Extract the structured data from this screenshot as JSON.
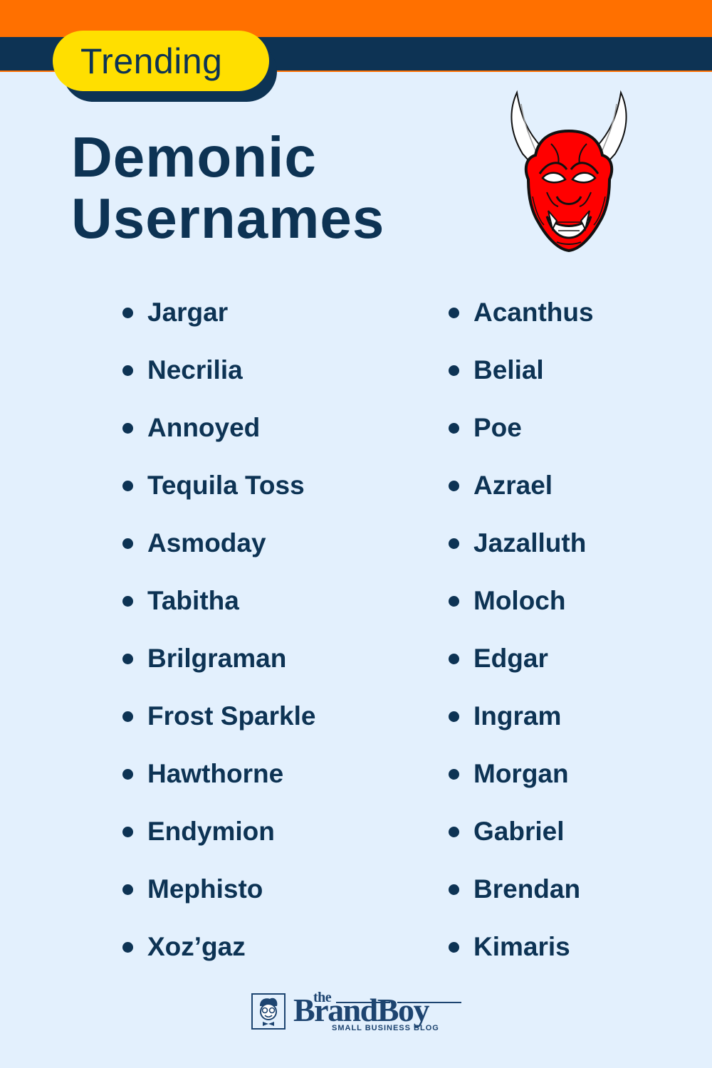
{
  "badge": {
    "label": "Trending"
  },
  "title": {
    "line1": "Demonic",
    "line2": "Usernames"
  },
  "illustration": {
    "icon": "oni-demon-mask-icon"
  },
  "lists": {
    "left": [
      "Jargar",
      "Necrilia",
      "Annoyed",
      "Tequila Toss",
      "Asmoday",
      "Tabitha",
      "Brilgraman",
      "Frost Sparkle",
      "Hawthorne",
      "Endymion",
      "Mephisto",
      "Xoz’gaz"
    ],
    "right": [
      "Acanthus",
      "Belial",
      "Poe",
      "Azrael",
      "Jazalluth",
      "Moloch",
      "Edgar",
      "Ingram",
      "Morgan",
      "Gabriel",
      "Brendan",
      "Kimaris"
    ]
  },
  "footer": {
    "logo_the": "the",
    "logo_brand": "BrandBoy",
    "logo_tagline": "SMALL BUSINESS BLOG",
    "logo_icon": "brandboy-mascot-icon"
  },
  "colors": {
    "orange": "#ff7000",
    "navy": "#0d3354",
    "yellow": "#ffdf00",
    "background": "#e3f0fd",
    "mask_red": "#ff0000"
  }
}
